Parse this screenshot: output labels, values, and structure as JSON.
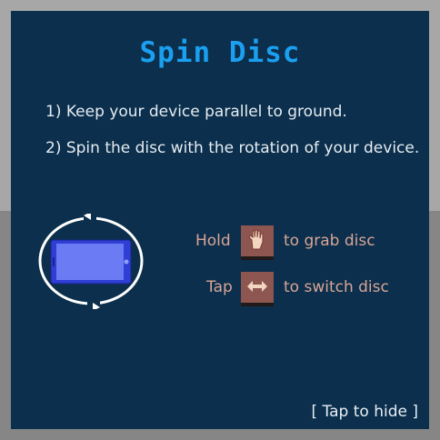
{
  "title": "Spin Disc",
  "instructions": [
    "1) Keep your device parallel to ground.",
    "2) Spin the disc with the rotation of your device."
  ],
  "controls": [
    {
      "action": "Hold",
      "icon": "hand-icon",
      "result": "to grab disc"
    },
    {
      "action": "Tap",
      "icon": "double-arrow-icon",
      "result": "to switch disc"
    }
  ],
  "hide_label": "[ Tap to hide ]",
  "colors": {
    "panel": "#0b2f4c",
    "title": "#1b9ff0",
    "control_text": "#d9a597",
    "button": "#8d5650",
    "device": "#2f3fd6",
    "device_screen": "#6a7bf4"
  }
}
